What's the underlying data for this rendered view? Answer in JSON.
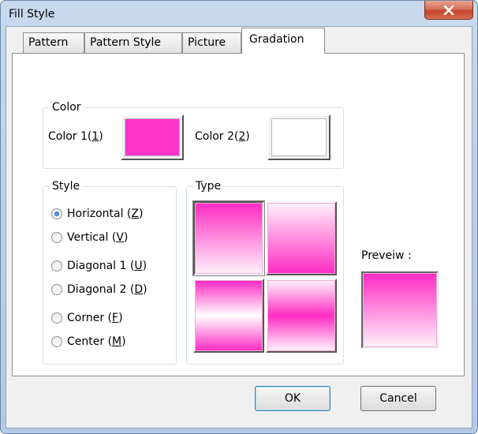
{
  "window": {
    "title": "Fill Style"
  },
  "tabs": [
    {
      "label": "Pattern"
    },
    {
      "label": "Pattern Style"
    },
    {
      "label": "Picture"
    },
    {
      "label": "Gradation"
    }
  ],
  "active_tab": "Gradation",
  "color_group": {
    "title": "Color",
    "color1_label": "Color 1(",
    "color1_key": "1",
    "color1_close": ")",
    "color1_value": "#ff33cc",
    "color2_label": "Color 2(",
    "color2_key": "2",
    "color2_close": ")",
    "color2_value": "#ffffff"
  },
  "style_group": {
    "title": "Style",
    "options": [
      {
        "text": "Horizontal (",
        "key": "Z",
        "close": ")",
        "checked": true
      },
      {
        "text": "Vertical (",
        "key": "V",
        "close": ")",
        "checked": false
      },
      {
        "text": "Diagonal 1 (",
        "key": "U",
        "close": ")",
        "checked": false
      },
      {
        "text": "Diagonal 2 (",
        "key": "D",
        "close": ")",
        "checked": false
      },
      {
        "text": "Corner (",
        "key": "F",
        "close": ")",
        "checked": false
      },
      {
        "text": "Center (",
        "key": "M",
        "close": ")",
        "checked": false
      }
    ]
  },
  "type_group": {
    "title": "Type",
    "selected_index": 0
  },
  "preview": {
    "label": "Preveiw :"
  },
  "buttons": {
    "ok": "OK",
    "cancel": "Cancel"
  },
  "colors": {
    "accent": "#ff33cc",
    "window_frame": "#bcd0ea",
    "close_button": "#c4442c"
  }
}
